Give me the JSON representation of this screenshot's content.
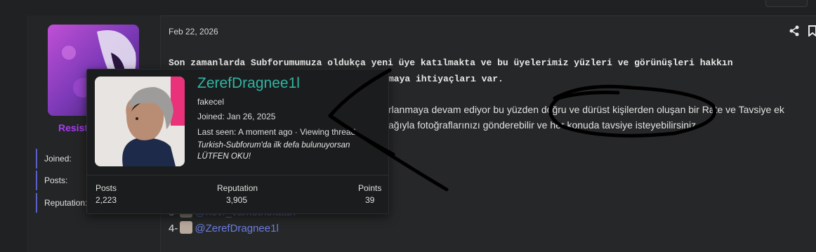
{
  "post": {
    "date": "Feb 22, 2026",
    "line1": "Son zamanlarda Subforumumuza oldukça yeni üye katılmakta ve bu üyelerimiz yüzleri ve görünüşleri hakkın",
    "line2": "maya ihtiyaçları var.",
    "line3": "rlanmaya devam ediyor bu yüzden doğru ve dürüst kişilerden oluşan bir Rate ve Tavsiye ek",
    "line4": "ağıyla fotoğraflarınızı gönderebilir ve her konuda tavsiye isteyebilirsiniz.",
    "mention3_prefix": "3-",
    "mention3": "@nevr_vamethefatah",
    "mention4_prefix": "4-",
    "mention4": "@ZerefDragnee1l"
  },
  "sidebar": {
    "username": "Resist",
    "joined_label": "Joined:",
    "posts_label": "Posts:",
    "reputation_label": "Reputation:"
  },
  "card": {
    "name": "ZerefDragnee1l",
    "user_title": "fakecel",
    "joined": "Joined: Jan 26, 2025",
    "last_seen": "Last seen: A moment ago · Viewing thread",
    "signature_line1": "Turkish-Subforum'da ilk defa bulunuyorsan",
    "signature_line2": "LÜTFEN OKU!",
    "stats": [
      {
        "label": "Posts",
        "value": "2,223"
      },
      {
        "label": "Reputation",
        "value": "3,905"
      },
      {
        "label": "Points",
        "value": "39"
      }
    ]
  },
  "icons": {
    "share": "share-icon",
    "bookmark": "bookmark-icon"
  },
  "colors": {
    "username_accent": "#2fb6a3",
    "sidebar_username": "#a83cf0",
    "mention": "#6a7fe0",
    "background": "#202122"
  }
}
